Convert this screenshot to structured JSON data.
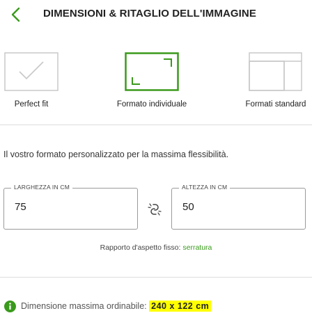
{
  "header": {
    "title": "DIMENSIONI & RITAGLIO DELL'IMMAGINE"
  },
  "options": [
    {
      "label": "Perfect fit",
      "icon": "checkmark-frame-icon"
    },
    {
      "label": "Formato individuale",
      "icon": "crop-corners-icon",
      "selected": true
    },
    {
      "label": "Formati standard",
      "icon": "stacked-frames-icon"
    }
  ],
  "description": "Il vostro formato personalizzato per la massima flessibilità.",
  "width_field": {
    "label": "LARGHEZZA IN CM",
    "value": "75"
  },
  "height_field": {
    "label": "ALTEZZA IN CM",
    "value": "50"
  },
  "aspect": {
    "text": "Rapporto d'aspetto fisso:",
    "link": "serratura"
  },
  "info": {
    "text": "Dimensione massima ordinabile:",
    "highlight": "240 x 122 cm"
  },
  "colors": {
    "accent": "#3a9a1c",
    "highlight": "#ffff00",
    "inactive": "#c8c8c8"
  }
}
